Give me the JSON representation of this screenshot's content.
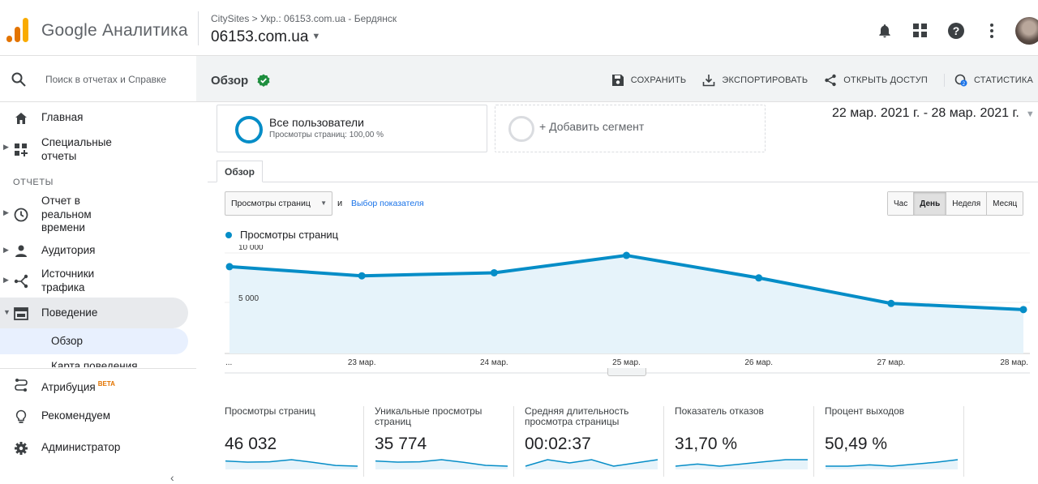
{
  "header": {
    "brand": "Google Аналитика",
    "breadcrumb": "CitySites > Укр.: 06153.com.ua - Бердянск",
    "property": "06153.com.ua"
  },
  "sidebar": {
    "search_placeholder": "Поиск в отчетах и Справке",
    "items": [
      {
        "label": "Главная",
        "icon": "home-icon"
      },
      {
        "label": "Специальные\nотчеты",
        "icon": "custom-reports-icon"
      },
      {
        "label": "Отчет в\nреальном\nвремени",
        "icon": "clock-icon"
      },
      {
        "label": "Аудитория",
        "icon": "person-icon"
      },
      {
        "label": "Источники\nтрафика",
        "icon": "acquisition-icon"
      },
      {
        "label": "Поведение",
        "icon": "behavior-icon"
      },
      {
        "label": "Атрибуция",
        "icon": "attribution-icon"
      },
      {
        "label": "Рекомендуем",
        "icon": "lightbulb-icon"
      },
      {
        "label": "Администратор",
        "icon": "gear-icon"
      }
    ],
    "section_reports": "ОТЧЕТЫ",
    "behavior_sub": [
      "Обзор",
      "Карта поведения"
    ],
    "beta": "BETA"
  },
  "main": {
    "title": "Обзор",
    "actions": [
      "СОХРАНИТЬ",
      "ЭКСПОРТИРОВАТЬ",
      "ОТКРЫТЬ ДОСТУП",
      "СТАТИСТИКА"
    ],
    "segment_title": "Все пользователи",
    "segment_sub": "Просмотры страниц: 100,00 %",
    "add_segment": "+ Добавить сегмент",
    "date_range": "22 мар. 2021 г. - 28 мар. 2021 г.",
    "tab": "Обзор",
    "metric_select": "Просмотры страниц",
    "and": "и",
    "choose_metric": "Выбор показателя",
    "granularity": [
      "Час",
      "День",
      "Неделя",
      "Месяц"
    ],
    "granularity_active": "День",
    "legend": "Просмотры страниц"
  },
  "chart_data": {
    "type": "area",
    "series": [
      {
        "name": "Просмотры страниц",
        "values": [
          8500,
          7600,
          7900,
          9600,
          7400,
          4900,
          4300
        ]
      }
    ],
    "x": [
      "",
      "23 мар.",
      "24 мар.",
      "25 мар.",
      "26 мар.",
      "27 мар.",
      "28 мар."
    ],
    "x_first_label": "...",
    "y_ticks": [
      "10 000",
      "5 000"
    ],
    "ylim": [
      0,
      10000
    ],
    "color": "#058dc7"
  },
  "scorecards": [
    {
      "title": "Просмотры страниц",
      "value": "46 032",
      "spark": [
        8500,
        7600,
        7900,
        9600,
        7400,
        4900,
        4300
      ]
    },
    {
      "title": "Уникальные просмотры страниц",
      "value": "35 774",
      "spark": [
        6600,
        5900,
        6100,
        7400,
        5800,
        3900,
        3400
      ]
    },
    {
      "title": "Средняя длительность просмотра страницы",
      "value": "00:02:37",
      "spark": [
        5,
        6,
        5.5,
        6,
        5,
        5.5,
        6
      ]
    },
    {
      "title": "Показатель отказов",
      "value": "31,70 %",
      "spark": [
        3,
        4,
        3,
        4,
        5,
        6,
        6
      ]
    },
    {
      "title": "Процент выходов",
      "value": "50,49 %",
      "spark": [
        5,
        5,
        5.2,
        5,
        5.3,
        5.6,
        6
      ]
    }
  ]
}
